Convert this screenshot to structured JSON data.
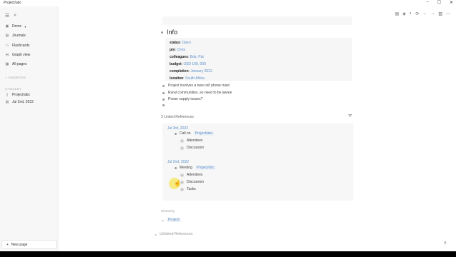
{
  "window": {
    "title": "Project/abc"
  },
  "sidebar": {
    "graph_name": "Demo",
    "nav": [
      {
        "label": "Journals",
        "icon": "calendar-icon"
      },
      {
        "label": "Flashcards",
        "icon": "cards-icon"
      },
      {
        "label": "Graph view",
        "icon": "graph-icon"
      },
      {
        "label": "All pages",
        "icon": "pages-icon"
      }
    ],
    "favorites_label": "FAVORITES",
    "recent_label": "RECENT",
    "recent": [
      {
        "label": "Project/abc",
        "icon": "page-icon"
      },
      {
        "label": "Jul 2nd, 2022",
        "icon": "calendar-icon"
      }
    ],
    "new_page": "New page"
  },
  "page": {
    "heading": "Info",
    "properties": [
      {
        "key": "status",
        "value": "Open",
        "link": true
      },
      {
        "key": "pm",
        "value": "Chris",
        "link": true
      },
      {
        "key": "colleagues",
        "value": "Bob, Pat",
        "link": true
      },
      {
        "key": "budget",
        "value": "USD 100, 000",
        "link": true
      },
      {
        "key": "completion",
        "value": "January 2023",
        "link": true
      },
      {
        "key": "location",
        "value": "South Africa",
        "link": true
      }
    ],
    "blocks": [
      "Project involves a new cell phone mast",
      "Rural communities, so need to be aware",
      "Power supply issues?",
      ""
    ]
  },
  "references": {
    "heading": "2 Linked References",
    "cards": [
      {
        "date": "Jul 3rd, 2023",
        "parent_text": "Call on",
        "parent_tag": "Project/abc",
        "children": [
          "Attendees",
          "Discussion"
        ]
      },
      {
        "date": "Jul 2nd, 2022",
        "parent_text": "Meeting",
        "parent_tag": "Project/abc",
        "children": [
          "Attendees",
          "Discussion",
          "Tasks"
        ]
      }
    ]
  },
  "hierarchy": {
    "label": "Hierarchy",
    "item": "Project"
  },
  "unlinked": {
    "label": "Unlinked References"
  },
  "help": "?"
}
